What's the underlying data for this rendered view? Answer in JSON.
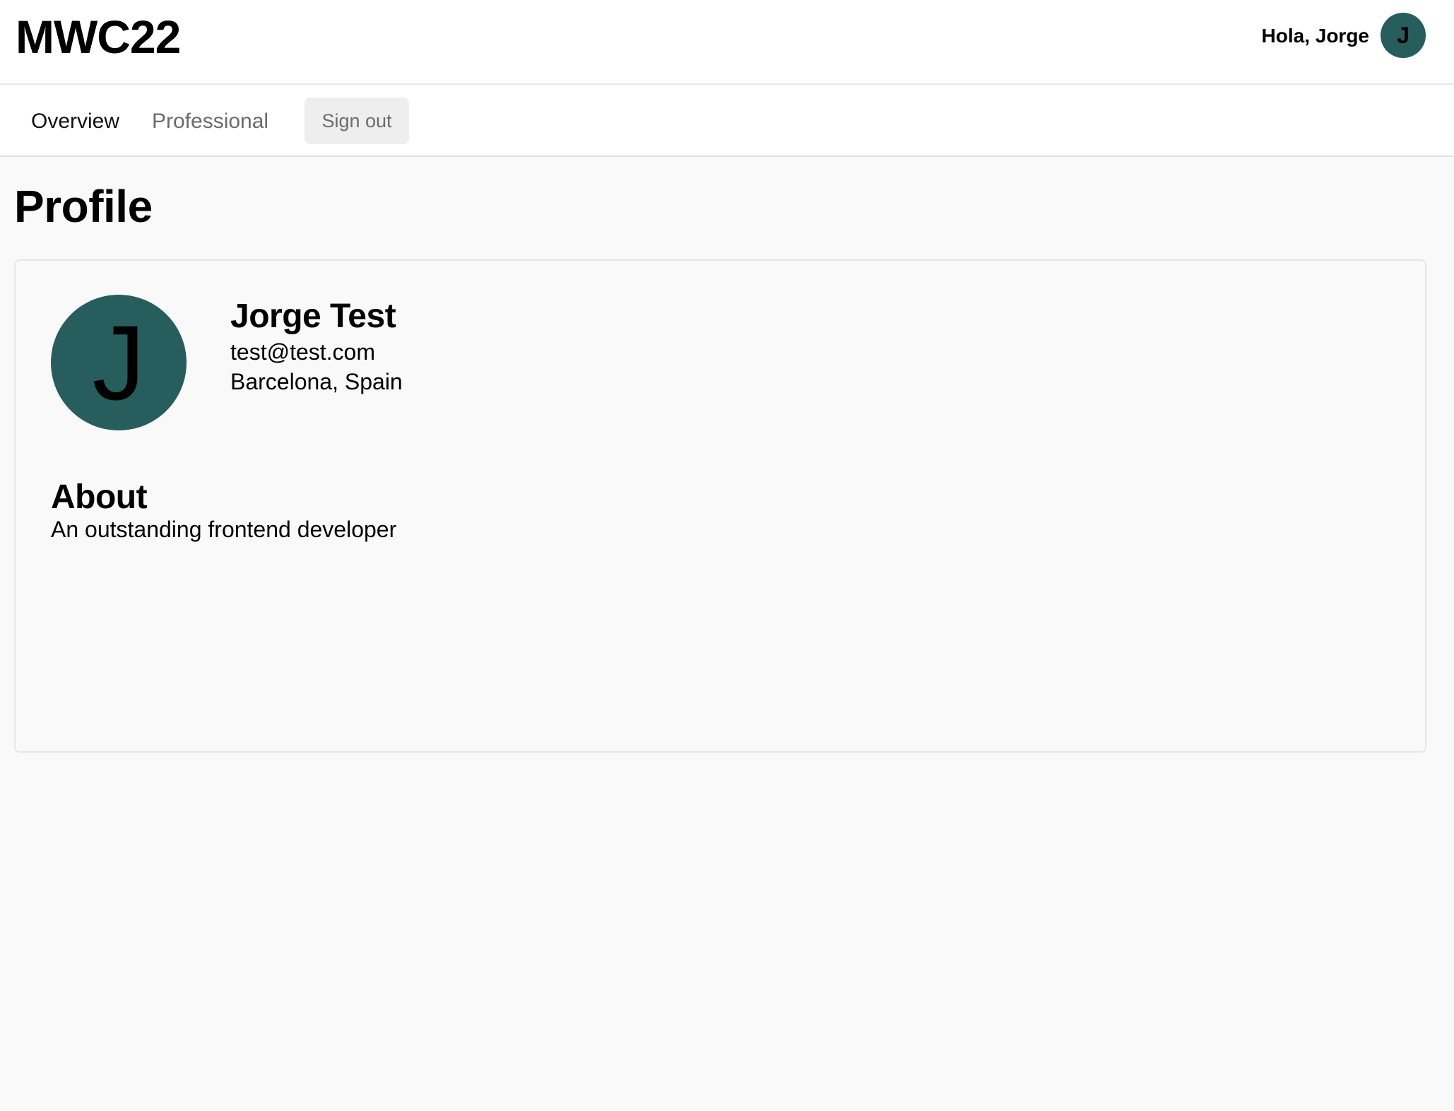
{
  "header": {
    "app_title": "MWC22",
    "greeting": "Hola, Jorge",
    "avatar_initial": "J"
  },
  "nav": {
    "items": [
      {
        "label": "Overview",
        "active": true
      },
      {
        "label": "Professional",
        "active": false
      }
    ],
    "signout_label": "Sign out"
  },
  "main": {
    "page_title": "Profile",
    "profile": {
      "avatar_initial": "J",
      "name": "Jorge Test",
      "email": "test@test.com",
      "location": "Barcelona, Spain",
      "about_heading": "About",
      "about_text": "An outstanding frontend developer"
    }
  },
  "colors": {
    "avatar_bg": "#275d5d",
    "page_bg": "#f9f9f9",
    "button_bg": "#eeeeee"
  }
}
